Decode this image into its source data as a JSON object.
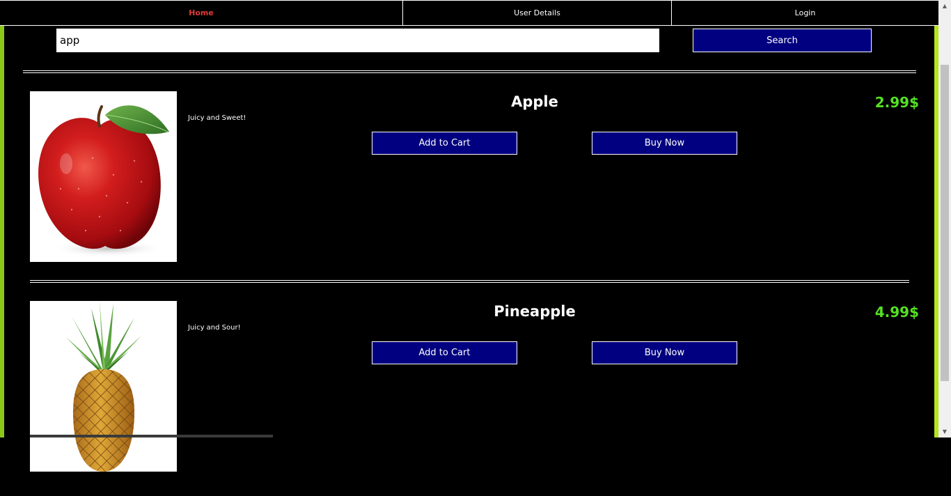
{
  "nav": {
    "home": "Home",
    "user_details": "User Details",
    "login": "Login"
  },
  "search": {
    "value": "app",
    "button_label": "Search"
  },
  "products": [
    {
      "name": "Apple",
      "description": "Juicy and Sweet!",
      "price": "2.99$",
      "add_to_cart": "Add to Cart",
      "buy_now": "Buy Now"
    },
    {
      "name": "Pineapple",
      "description": "Juicy and Sour!",
      "price": "4.99$",
      "add_to_cart": "Add to Cart",
      "buy_now": "Buy Now"
    }
  ],
  "colors": {
    "accent_left": "#8bc81a",
    "accent_right": "#b5e61d",
    "button_bg": "#000080",
    "price": "#55e022",
    "nav_active": "#e03a3a"
  }
}
